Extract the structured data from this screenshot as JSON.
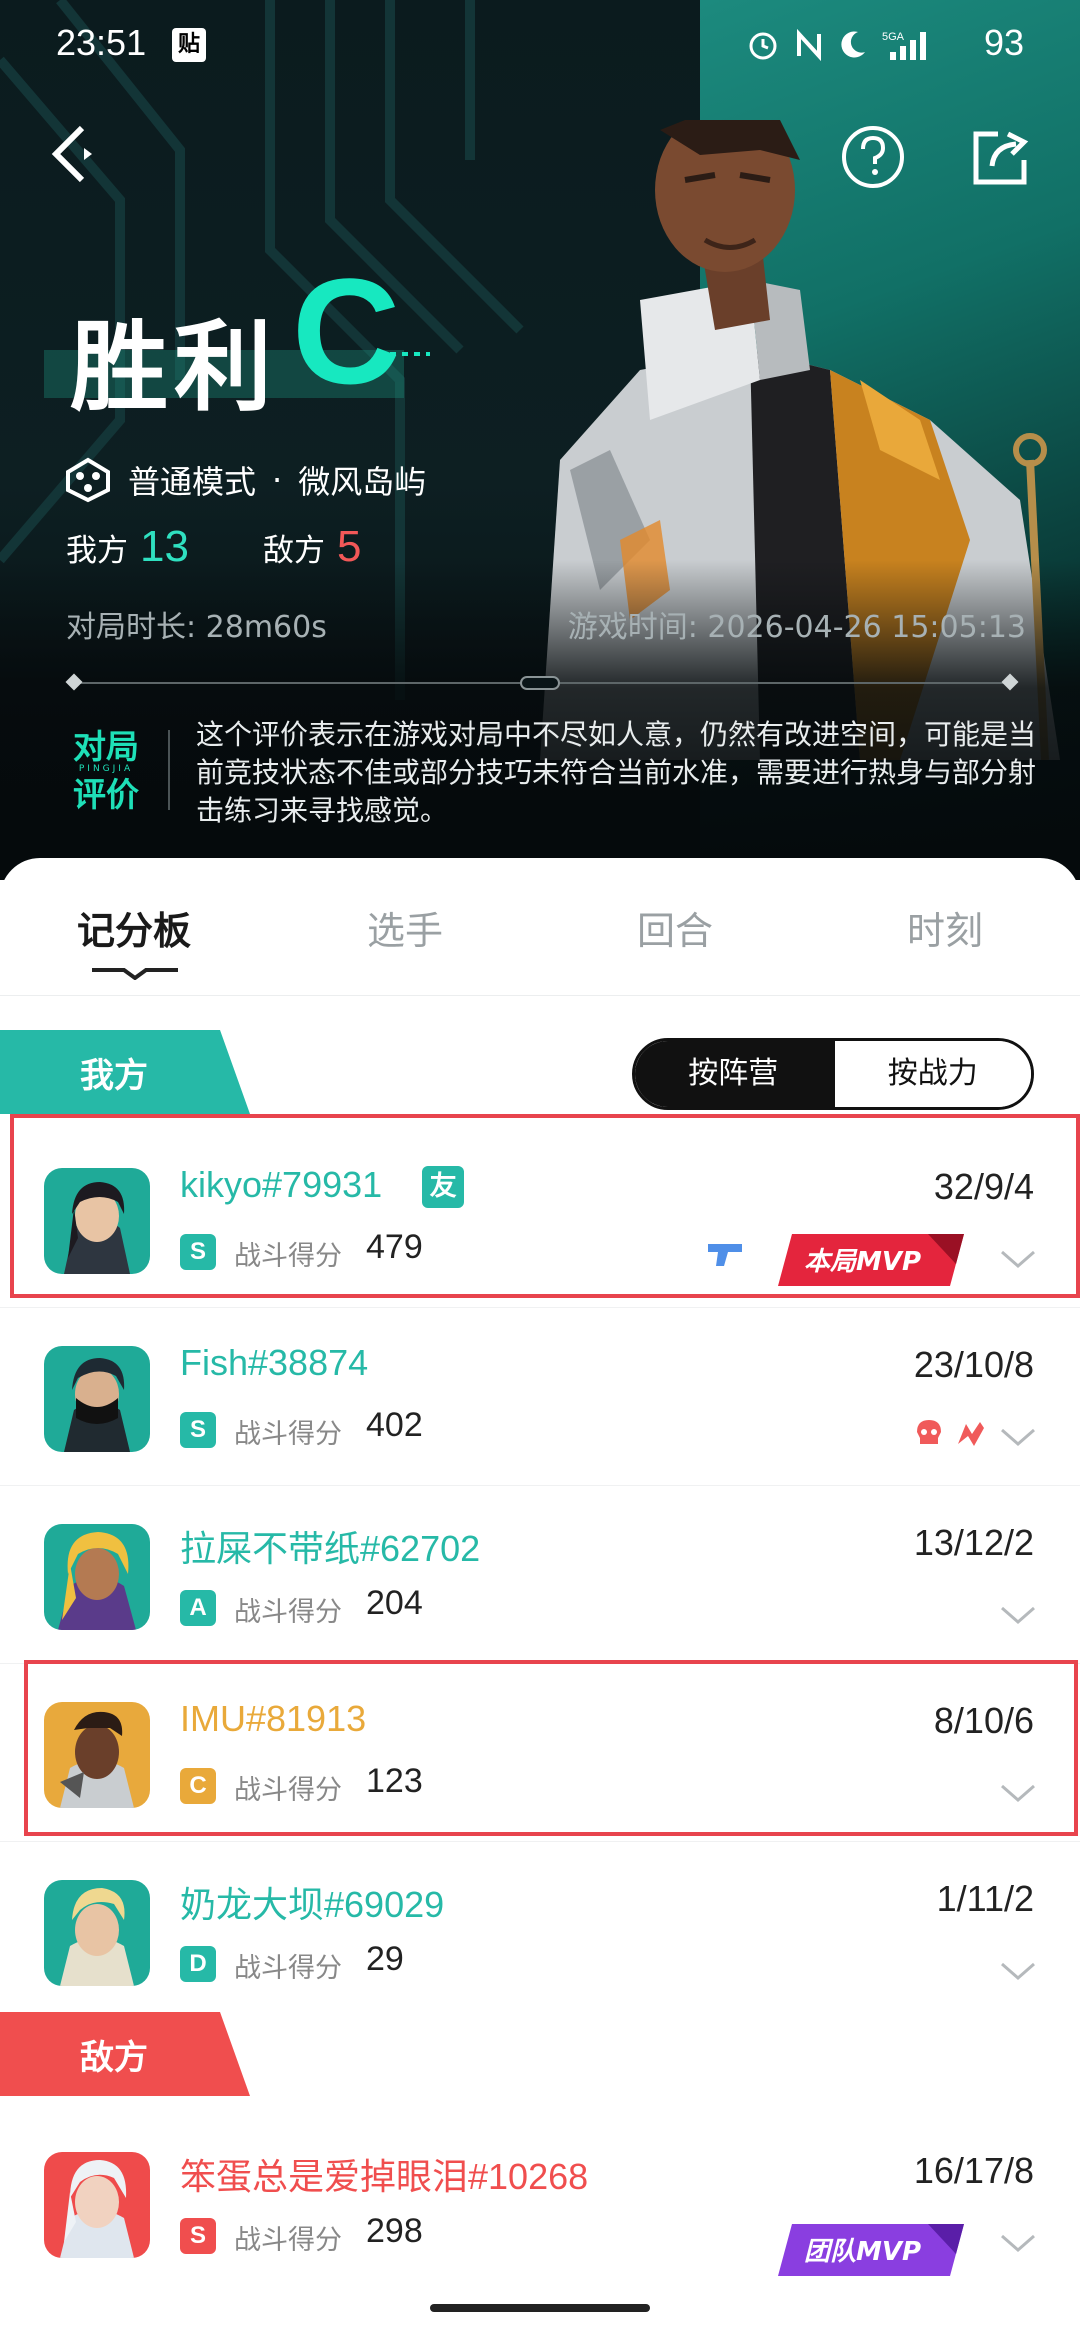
{
  "status_bar": {
    "time": "23:51",
    "tie_label": "贴",
    "battery": "93",
    "signal_label": "5GA"
  },
  "hero": {
    "result": "胜利",
    "grade": "C",
    "mode": "普通模式",
    "mode_sep": "·",
    "map": "微风岛屿",
    "ally_label": "我方",
    "ally_rounds": "13",
    "enemy_label": "敌方",
    "enemy_rounds": "5",
    "duration": "对局时长: 28m60s",
    "game_time": "游戏时间: 2026-04-26 15:05:13",
    "eval_title_line1": "对局",
    "eval_title_line2": "评价",
    "eval_pinyin": "PINGJIA",
    "eval_text": "这个评价表示在游戏对局中不尽如人意，仍然有改进空间，可能是当前竞技状态不佳或部分技巧未符合当前水准，需要进行热身与部分射击练习来寻找感觉。"
  },
  "tabs": [
    {
      "label": "记分板"
    },
    {
      "label": "选手"
    },
    {
      "label": "回合"
    },
    {
      "label": "时刻"
    }
  ],
  "sort": {
    "by_team": "按阵营",
    "by_power": "按战力"
  },
  "ally_team": {
    "label": "我方",
    "players": [
      {
        "name": "kikyo#79931",
        "friend": "友",
        "rank": "S",
        "score_label": "战斗得分",
        "score": "479",
        "kda": "32/9/4",
        "mvp": "本局MVP",
        "name_color": "#26b9a7",
        "rank_color": "#26b9a7"
      },
      {
        "name": "Fish#38874",
        "rank": "S",
        "score_label": "战斗得分",
        "score": "402",
        "kda": "23/10/8",
        "name_color": "#26b9a7",
        "rank_color": "#26b9a7"
      },
      {
        "name": "拉屎不带纸#62702",
        "rank": "A",
        "score_label": "战斗得分",
        "score": "204",
        "kda": "13/12/2",
        "name_color": "#26b9a7",
        "rank_color": "#26b9a7"
      },
      {
        "name": "IMU#81913",
        "rank": "C",
        "score_label": "战斗得分",
        "score": "123",
        "kda": "8/10/6",
        "name_color": "#e9a93a",
        "rank_color": "#e9a93a"
      },
      {
        "name": "奶龙大坝#69029",
        "rank": "D",
        "score_label": "战斗得分",
        "score": "29",
        "kda": "1/11/2",
        "name_color": "#26b9a7",
        "rank_color": "#26b9a7"
      }
    ]
  },
  "enemy_team": {
    "label": "敌方",
    "players": [
      {
        "name": "笨蛋总是爱掉眼泪#10268",
        "rank": "S",
        "score_label": "战斗得分",
        "score": "298",
        "kda": "16/17/8",
        "mvp": "团队MVP",
        "name_color": "#f04e4e",
        "rank_color": "#f04e4e"
      }
    ]
  },
  "colors": {
    "accent": "#26b9a7",
    "enemy": "#f04e4e",
    "highlight": "#e8444d",
    "grade": "#17e8c0"
  }
}
